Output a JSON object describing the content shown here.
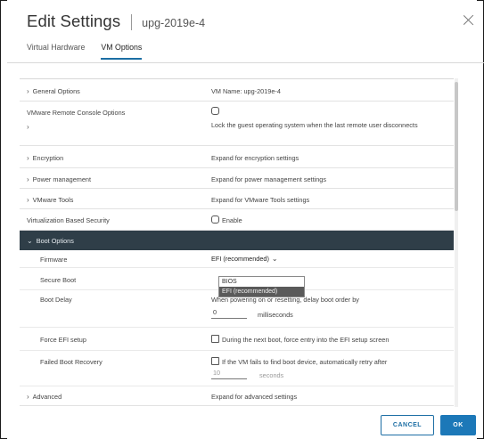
{
  "dialog": {
    "title": "Edit Settings",
    "subtitle": "upg-2019e-4"
  },
  "tabs": [
    {
      "label": "Virtual Hardware",
      "active": false
    },
    {
      "label": "VM Options",
      "active": true
    }
  ],
  "rows": {
    "general_options": {
      "label": "General Options",
      "value": "VM Name: upg-2019e-4"
    },
    "vmrc": {
      "label": "VMware Remote Console Options",
      "value": "Lock the guest operating system when the last remote user disconnects"
    },
    "encryption": {
      "label": "Encryption",
      "value": "Expand for encryption settings"
    },
    "power": {
      "label": "Power management",
      "value": "Expand for power management settings"
    },
    "tools": {
      "label": "VMware Tools",
      "value": "Expand for VMware Tools settings"
    },
    "vbs": {
      "label": "Virtualization Based Security",
      "value": "Enable"
    },
    "boot": {
      "label": "Boot Options"
    },
    "firmware": {
      "label": "Firmware",
      "value": "EFI (recommended)"
    },
    "secure_boot": {
      "label": "Secure Boot"
    },
    "boot_delay": {
      "label": "Boot Delay",
      "value": "When powering on or resetting, delay boot order by",
      "input": "0",
      "unit": "milliseconds"
    },
    "force_efi": {
      "label": "Force EFI setup",
      "value": "During the next boot, force entry into the EFI setup screen"
    },
    "failed_boot": {
      "label": "Failed Boot Recovery",
      "value": "If the VM fails to find boot device, automatically retry after",
      "input": "10",
      "unit": "seconds"
    },
    "advanced": {
      "label": "Advanced",
      "value": "Expand for advanced settings"
    }
  },
  "firmware_options": [
    "BIOS",
    "EFI (recommended)"
  ],
  "buttons": {
    "cancel": "CANCEL",
    "ok": "OK"
  },
  "colors": {
    "accent": "#1c78b8",
    "boot_header_bg": "#2f3e48"
  }
}
